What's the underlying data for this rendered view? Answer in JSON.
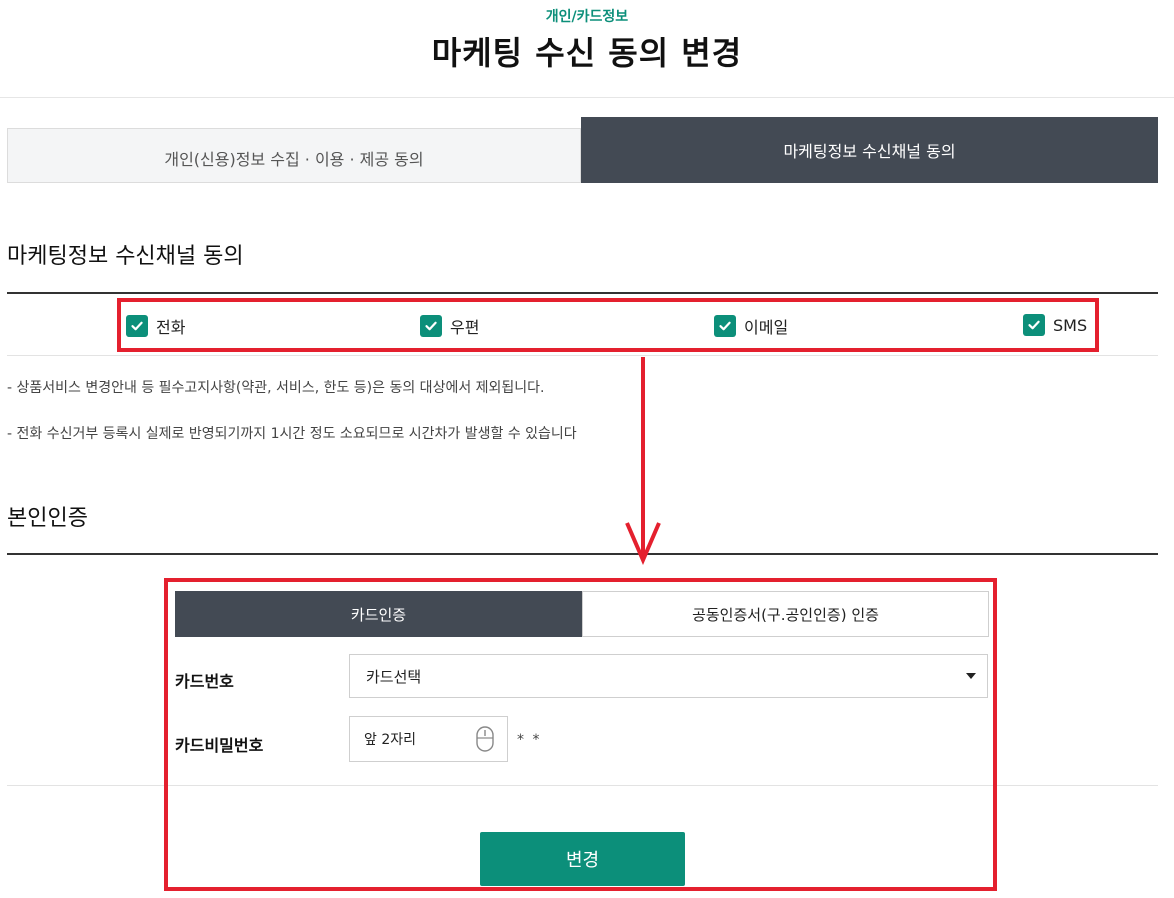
{
  "header": {
    "breadcrumb": "개인/카드정보",
    "title": "마케팅 수신 동의 변경"
  },
  "tabs": [
    {
      "label": "개인(신용)정보 수집 · 이용 · 제공 동의",
      "active": false
    },
    {
      "label": "마케팅정보 수신채널 동의",
      "active": true
    }
  ],
  "channels_section": {
    "title": "마케팅정보 수신채널 동의",
    "channels": [
      {
        "label": "전화",
        "checked": true
      },
      {
        "label": "우편",
        "checked": true
      },
      {
        "label": "이메일",
        "checked": true
      },
      {
        "label": "SMS",
        "checked": true
      }
    ],
    "notes": [
      "- 상품서비스 변경안내 등 필수고지사항(약관, 서비스, 한도 등)은 동의 대상에서 제외됩니다.",
      "- 전화 수신거부 등록시 실제로 반영되기까지 1시간 정도 소요되므로 시간차가 발생할 수 있습니다"
    ]
  },
  "auth_section": {
    "title": "본인인증",
    "tabs": [
      {
        "label": "카드인증",
        "active": true
      },
      {
        "label": "공동인증서(구.공인인증) 인증",
        "active": false
      }
    ],
    "card_number_label": "카드번호",
    "card_select_value": "카드선택",
    "card_pw_label": "카드비밀번호",
    "card_pw_placeholder": "앞 2자리",
    "card_pw_suffix": "* *",
    "submit_label": "변경"
  },
  "colors": {
    "accent": "#0c8f7a",
    "dark_tab": "#434a54",
    "annotation_red": "#e4202e"
  }
}
